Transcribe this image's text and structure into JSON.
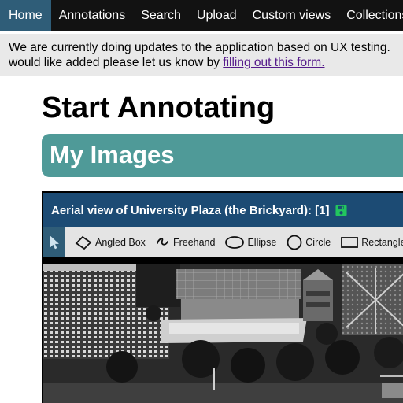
{
  "nav": {
    "items": [
      "Home",
      "Annotations",
      "Search",
      "Upload",
      "Custom views",
      "Collections"
    ],
    "active": "Home"
  },
  "notice": {
    "line1": "We are currently doing updates to the application based on UX testing.",
    "line2_prefix": "would like added please let us know by ",
    "link_text": "filling out this form."
  },
  "page": {
    "title": "Start Annotating",
    "section_title": "My Images"
  },
  "viewer": {
    "title": "Aerial view of University Plaza (the Brickyard): [1]",
    "save_icon": "save-icon",
    "tools": [
      {
        "label": "Angled Box",
        "icon": "angled-box-icon"
      },
      {
        "label": "Freehand",
        "icon": "freehand-icon"
      },
      {
        "label": "Ellipse",
        "icon": "ellipse-icon"
      },
      {
        "label": "Circle",
        "icon": "circle-icon"
      },
      {
        "label": "Rectangle",
        "icon": "rectangle-icon"
      }
    ],
    "select_tool_icon": "cursor-icon"
  },
  "colors": {
    "nav_bg": "#121212",
    "nav_active": "#2f5d78",
    "notice_bg": "#e9e9e9",
    "section_bg": "#4f9a98",
    "viewer_header": "#1c4b74",
    "save_green": "#22c55e"
  }
}
